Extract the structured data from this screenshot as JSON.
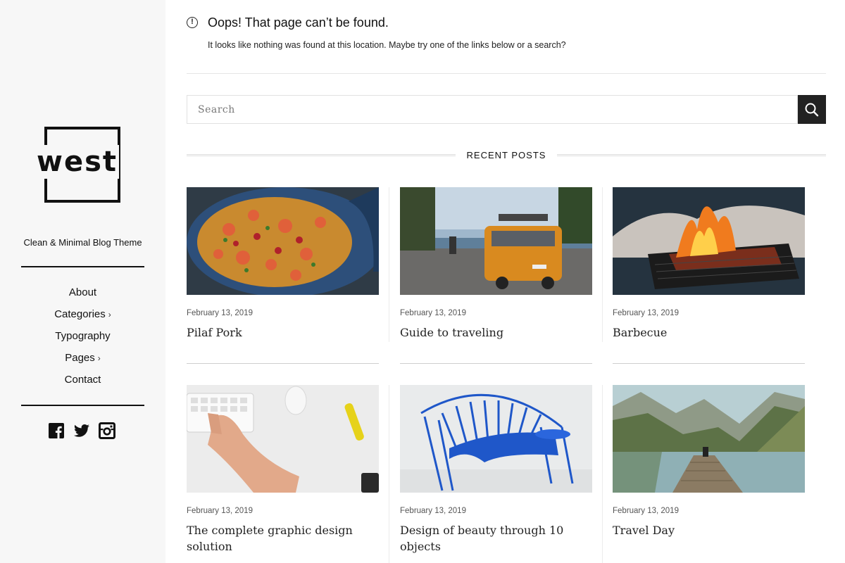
{
  "sidebar": {
    "logo_text": "west",
    "tagline": "Clean & Minimal Blog Theme",
    "nav": [
      {
        "label": "About",
        "has_submenu": false
      },
      {
        "label": "Categories",
        "has_submenu": true
      },
      {
        "label": "Typography",
        "has_submenu": false
      },
      {
        "label": "Pages",
        "has_submenu": true
      },
      {
        "label": "Contact",
        "has_submenu": false
      }
    ],
    "social": [
      "facebook-icon",
      "twitter-icon",
      "instagram-icon"
    ]
  },
  "notfound": {
    "title": "Oops! That page can’t be found.",
    "message": "It looks like nothing was found at this location. Maybe try one of the links below or a search?"
  },
  "search": {
    "placeholder": "Search",
    "button_icon": "search-icon"
  },
  "recent": {
    "heading": "RECENT POSTS",
    "posts": [
      {
        "date": "February 13, 2019",
        "title": "Pilaf Pork"
      },
      {
        "date": "February 13, 2019",
        "title": "Guide to traveling"
      },
      {
        "date": "February 13, 2019",
        "title": "Barbecue"
      },
      {
        "date": "February 13, 2019",
        "title": "The complete graphic design solution"
      },
      {
        "date": "February 13, 2019",
        "title": "Design of beauty through 10 objects"
      },
      {
        "date": "February 13, 2019",
        "title": "Travel Day"
      }
    ]
  },
  "colors": {
    "sidebar_bg": "#f7f7f7",
    "text": "#111111",
    "search_button": "#222222"
  }
}
